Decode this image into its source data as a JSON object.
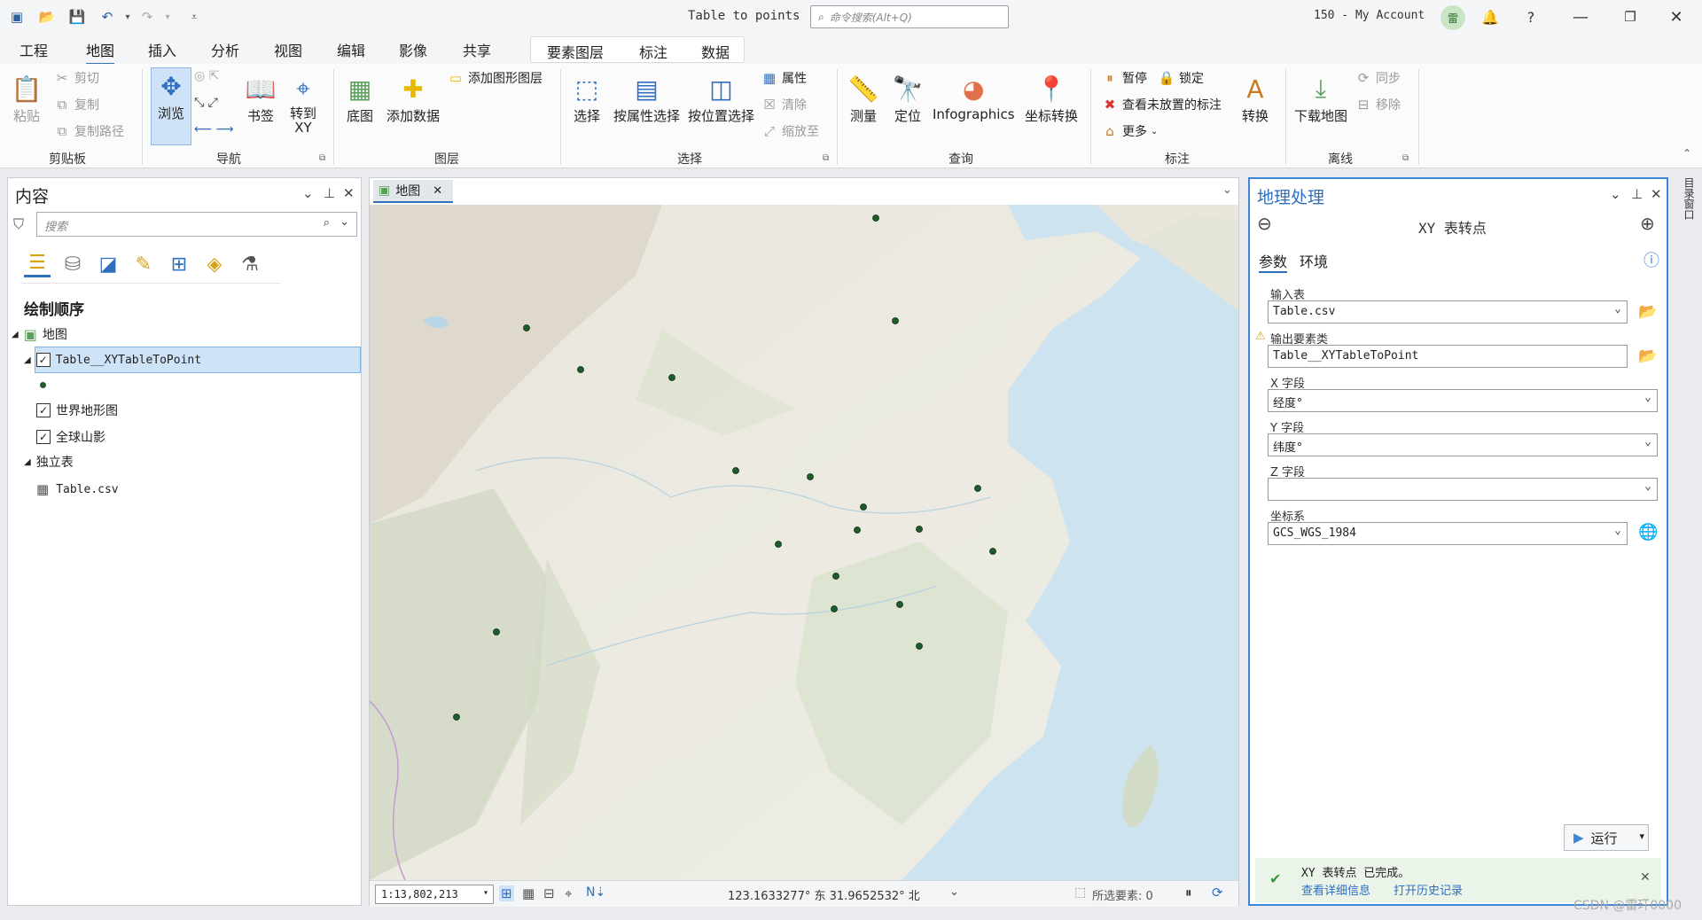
{
  "title_bar": {
    "doc_title": "Table to points",
    "search_placeholder": "命令搜索(Alt+Q)",
    "account": "150 - My Account",
    "avatar": "雷",
    "quick_access_icons": [
      "new-project-icon",
      "open-project-icon",
      "save-icon",
      "undo-icon",
      "redo-icon",
      "customize-icon"
    ]
  },
  "ribbon_tabs": [
    "工程",
    "地图",
    "插入",
    "分析",
    "视图",
    "编辑",
    "影像",
    "共享"
  ],
  "ribbon_active_tab": "地图",
  "context_tabs": [
    "要素图层",
    "标注",
    "数据"
  ],
  "ribbon": {
    "clipboard": {
      "label": "剪贴板",
      "paste": "粘贴",
      "cut": "剪切",
      "copy": "复制",
      "copy_path": "复制路径"
    },
    "navigate": {
      "label": "导航",
      "explore": "浏览",
      "bookmarks": "书签",
      "goto_xy": "转到\nXY"
    },
    "layer": {
      "label": "图层",
      "basemap": "底图",
      "add_data": "添加数据",
      "add_graphics": "添加图形图层"
    },
    "selection": {
      "label": "选择",
      "select": "选择",
      "by_attr": "按属性选择",
      "by_loc": "按位置选择",
      "attributes": "属性",
      "clear": "清除",
      "zoom_to": "缩放至"
    },
    "inquiry": {
      "label": "查询",
      "measure": "测量",
      "locate": "定位",
      "infographics": "Infographics",
      "convert_coords": "坐标转换"
    },
    "labeling": {
      "label": "标注",
      "pause": "暂停",
      "lock": "锁定",
      "unplaced": "查看未放置的标注",
      "more": "更多",
      "convert": "转换"
    },
    "offline": {
      "label": "离线",
      "download": "下载地图",
      "sync": "同步",
      "remove": "移除"
    }
  },
  "contents": {
    "title": "内容",
    "search_placeholder": "搜索",
    "draw_order": "绘制顺序",
    "map_name": "地图",
    "layers": [
      {
        "name": "Table__XYTableToPoint",
        "checked": true,
        "selected": true
      },
      {
        "name": "世界地形图",
        "checked": true
      },
      {
        "name": "全球山影",
        "checked": true
      }
    ],
    "standalone_tables_label": "独立表",
    "tables": [
      "Table.csv"
    ]
  },
  "map": {
    "tab_label": "地图",
    "scale": "1:13,802,213",
    "coords": "123.1633277° 东  31.9652532° 北",
    "selected_features": "所选要素: 0",
    "point_color": "#1f5a2a"
  },
  "geoprocessing": {
    "title": "地理处理",
    "tool_name": "XY 表转点",
    "tabs": [
      "参数",
      "环境"
    ],
    "fields": [
      {
        "label": "输入表",
        "value": "Table.csv",
        "type": "dropdown"
      },
      {
        "label": "输出要素类",
        "value": "Table__XYTableToPoint",
        "type": "text",
        "warning": true
      },
      {
        "label": "X 字段",
        "value": "经度°",
        "type": "dropdown"
      },
      {
        "label": "Y 字段",
        "value": "纬度°",
        "type": "dropdown"
      },
      {
        "label": "Z 字段",
        "value": "",
        "type": "dropdown"
      },
      {
        "label": "坐标系",
        "value": "GCS_WGS_1984",
        "type": "dropdown"
      }
    ],
    "run_label": "运行",
    "message": "XY 表转点 已完成。",
    "link_details": "查看详细信息",
    "link_history": "打开历史记录"
  },
  "side_tab": "目录窗口",
  "watermark": "CSDN @雷玕0000"
}
